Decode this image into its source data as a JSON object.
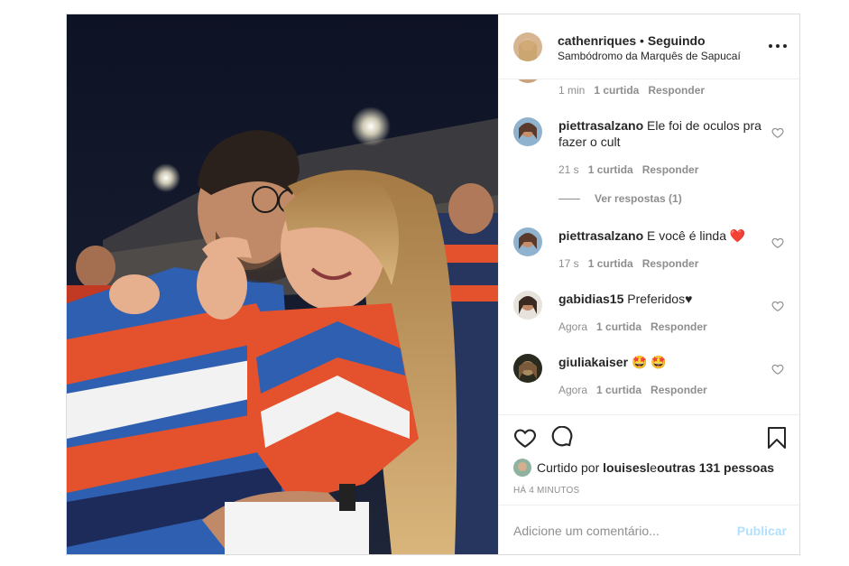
{
  "post": {
    "username": "cathenriques",
    "separator": " • ",
    "follow_status": "Seguindo",
    "location": "Sambódromo da Marquês de Sapucaí"
  },
  "comments": [
    {
      "username": "",
      "text": "",
      "time": "1 min",
      "likes": "1 curtida",
      "reply": "Responder"
    },
    {
      "username": "piettrasalzano",
      "text": "Ele foi de oculos pra fazer o cult",
      "time": "21 s",
      "likes": "1 curtida",
      "reply": "Responder",
      "view_replies": "Ver respostas (1)"
    },
    {
      "username": "piettrasalzano",
      "text": "E você é linda",
      "emoji": "❤️",
      "time": "17 s",
      "likes": "1 curtida",
      "reply": "Responder"
    },
    {
      "username": "gabidias15",
      "text": "Preferidos♥",
      "time": "Agora",
      "likes": "1 curtida",
      "reply": "Responder"
    },
    {
      "username": "giuliakaiser",
      "text": "",
      "emoji": "🤩 🤩",
      "time": "Agora",
      "likes": "1 curtida",
      "reply": "Responder"
    }
  ],
  "likes": {
    "prefix": "Curtido por ",
    "user": "louisesl",
    "middle": " e ",
    "others": "outras 131 pessoas"
  },
  "timestamp": "HÁ 4 MINUTOS",
  "add_comment": {
    "placeholder": "Adicione um comentário...",
    "publish": "Publicar"
  },
  "icons": {
    "like": "heart-icon",
    "comment": "comment-bubble-icon",
    "save": "bookmark-icon",
    "more": "more-dots-icon"
  },
  "colors": {
    "text": "#262626",
    "muted": "#8e8e8e",
    "border": "#dbdbdb",
    "publish_disabled": "#b2dffc",
    "heart_red": "#ed4956"
  }
}
